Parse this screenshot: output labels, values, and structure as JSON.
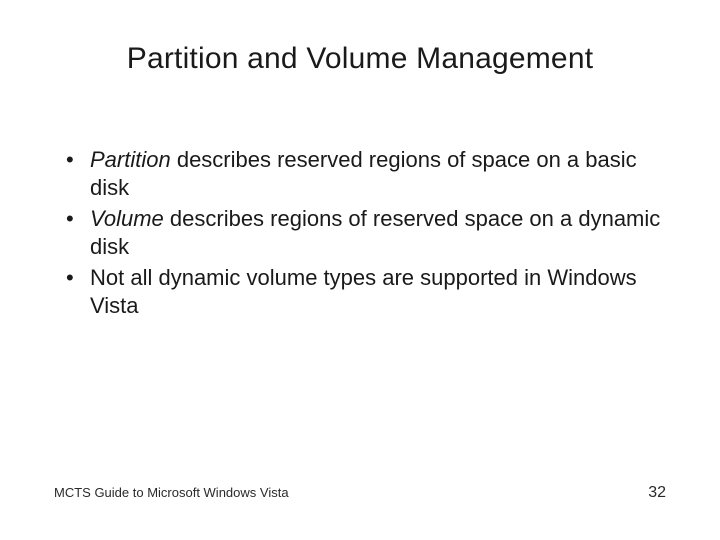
{
  "title": "Partition and Volume Management",
  "bullets": [
    {
      "italic": "Partition",
      "rest": " describes reserved regions of space on a basic disk"
    },
    {
      "italic": "Volume",
      "rest": " describes regions of reserved space on a dynamic disk"
    },
    {
      "italic": "",
      "rest": "Not all dynamic volume types are supported in Windows Vista"
    }
  ],
  "footer": {
    "source": "MCTS Guide to Microsoft Windows Vista",
    "page": "32"
  }
}
